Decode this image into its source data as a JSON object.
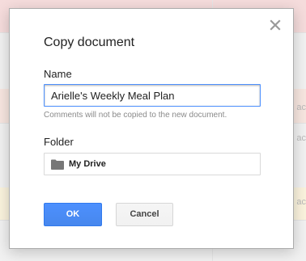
{
  "background": {
    "side_text": [
      "ac",
      "ac",
      "ac"
    ]
  },
  "dialog": {
    "title": "Copy document",
    "close_icon": "close-icon",
    "name_label": "Name",
    "name_value": "Arielle's Weekly Meal Plan",
    "hint": "Comments will not be copied to the new document.",
    "folder_label": "Folder",
    "folder_icon": "folder-icon",
    "folder_name": "My Drive",
    "ok_label": "OK",
    "cancel_label": "Cancel"
  },
  "colors": {
    "primary_button": "#4d90fe",
    "input_focus_border": "#4d90fe",
    "folder_icon": "#777777"
  }
}
